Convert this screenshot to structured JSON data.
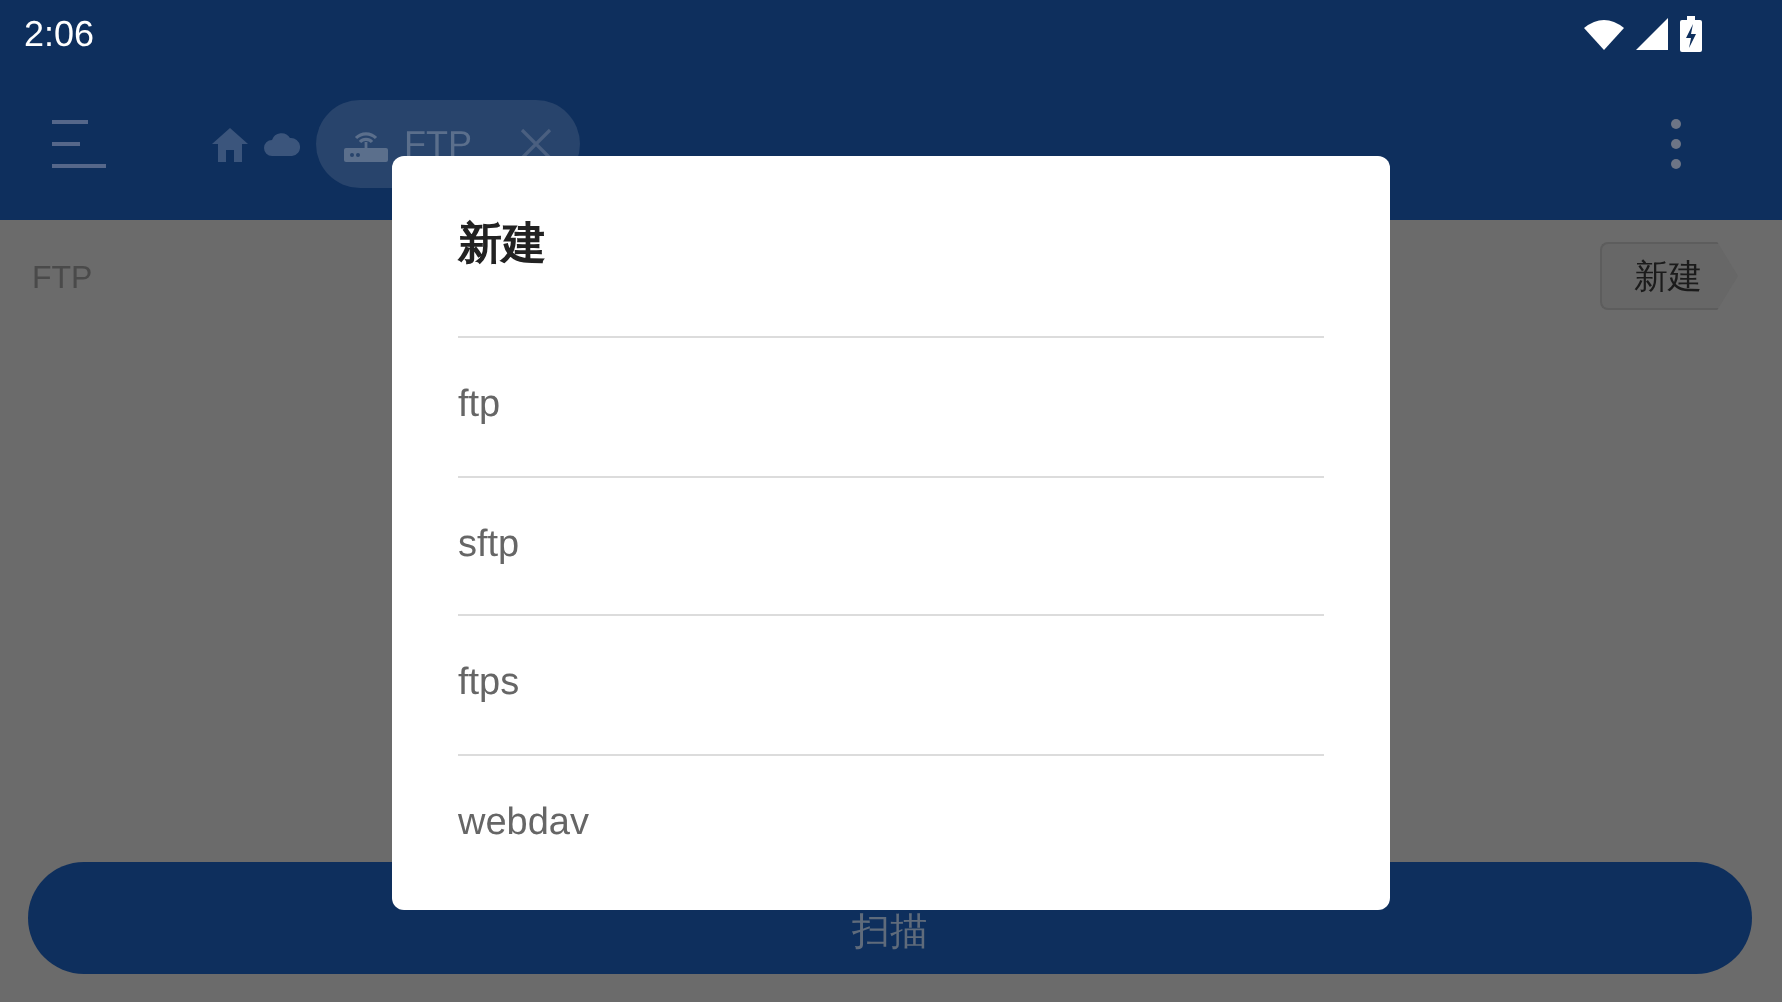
{
  "status_bar": {
    "time": "2:06"
  },
  "app_bar": {
    "breadcrumb": {
      "label": "FTP"
    }
  },
  "content": {
    "path": "FTP",
    "new_button": "新建"
  },
  "scan_button": "扫描",
  "dialog": {
    "title": "新建",
    "options": [
      {
        "label": "ftp"
      },
      {
        "label": "sftp"
      },
      {
        "label": "ftps"
      },
      {
        "label": "webdav"
      }
    ]
  }
}
